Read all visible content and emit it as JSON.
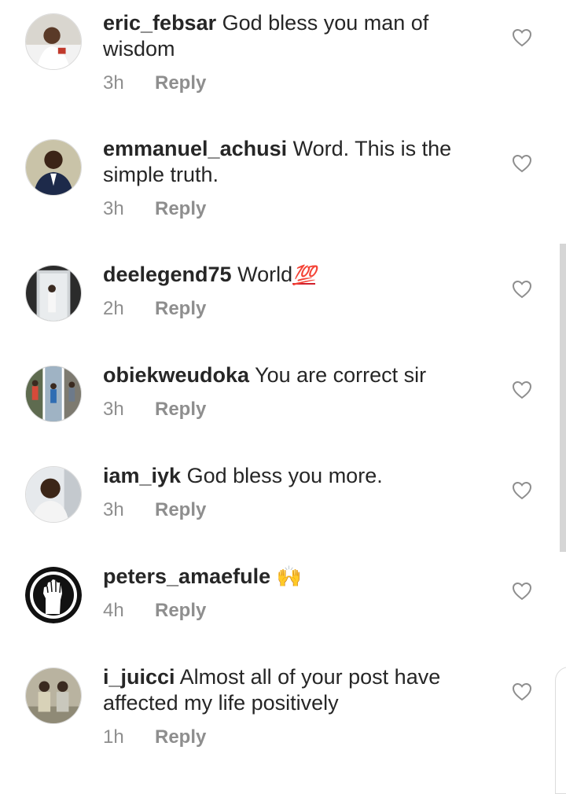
{
  "comments": [
    {
      "username": "eric_febsar",
      "text": "God bless you man of wisdom",
      "time": "3h",
      "reply": "Reply",
      "avatar": "profile-photo"
    },
    {
      "username": "emmanuel_achusi",
      "text": "Word. This is the simple truth.",
      "time": "3h",
      "reply": "Reply",
      "avatar": "profile-photo"
    },
    {
      "username": "deelegend75",
      "text": "World",
      "emoji": "💯",
      "time": "2h",
      "reply": "Reply",
      "avatar": "profile-photo"
    },
    {
      "username": "obiekweudoka",
      "text": "You are correct sir",
      "time": "3h",
      "reply": "Reply",
      "avatar": "profile-photo"
    },
    {
      "username": "iam_iyk",
      "text": "God bless you more.",
      "time": "3h",
      "reply": "Reply",
      "avatar": "profile-photo"
    },
    {
      "username": "peters_amaefule",
      "text": "",
      "emoji": "🙌",
      "time": "4h",
      "reply": "Reply",
      "avatar": "raised-fist-logo"
    },
    {
      "username": "i_juicci",
      "text": "Almost all of your post have affected my life positively",
      "time": "1h",
      "reply": "Reply",
      "avatar": "profile-photo"
    }
  ],
  "icons": {
    "like": "heart-outline-icon"
  },
  "colors": {
    "text": "#262626",
    "meta": "#8e8e8e",
    "icon": "#8e8e8e"
  }
}
